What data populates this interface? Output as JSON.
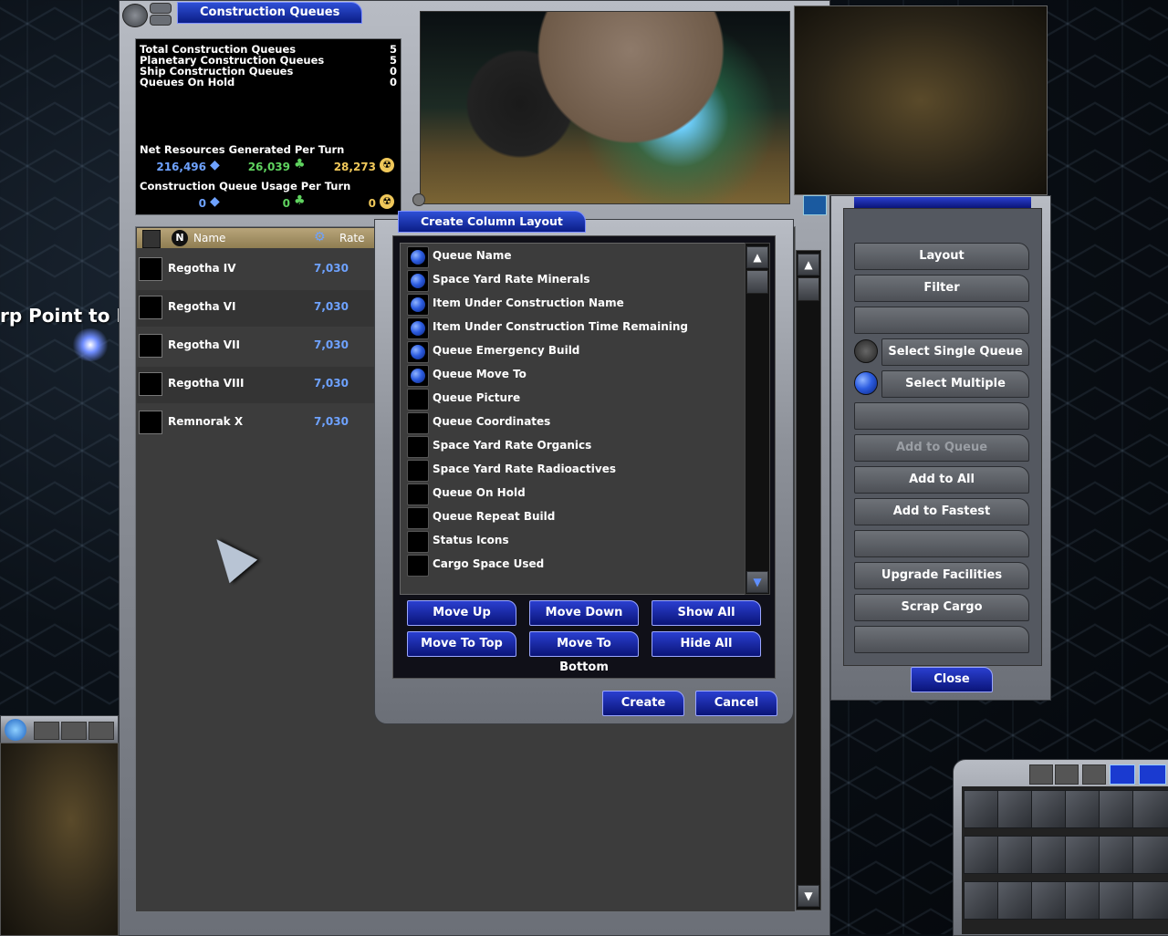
{
  "window": {
    "title": "Construction Queues"
  },
  "background_text": "rp Point to Re",
  "summary": {
    "lines": [
      {
        "label": "Total Construction Queues",
        "value": "5"
      },
      {
        "label": "Planetary Construction Queues",
        "value": "5"
      },
      {
        "label": "Ship Construction Queues",
        "value": "0"
      },
      {
        "label": "Queues On Hold",
        "value": "0"
      }
    ],
    "net_resources_label": "Net Resources Generated Per Turn",
    "net_resources": {
      "minerals": "216,496",
      "organics": "26,039",
      "radioactives": "28,273"
    },
    "usage_label": "Construction Queue Usage Per Turn",
    "usage": {
      "minerals": "0",
      "organics": "0",
      "radioactives": "0"
    }
  },
  "queue_table": {
    "headers": {
      "name": "Name",
      "rate": "Rate"
    },
    "rows": [
      {
        "name": "Regotha IV",
        "rate": "7,030"
      },
      {
        "name": "Regotha VI",
        "rate": "7,030"
      },
      {
        "name": "Regotha VII",
        "rate": "7,030"
      },
      {
        "name": "Regotha VIII",
        "rate": "7,030"
      },
      {
        "name": "Remnorak X",
        "rate": "7,030"
      }
    ]
  },
  "dialog": {
    "title": "Create Column Layout",
    "columns": [
      {
        "label": "Queue Name",
        "checked": true
      },
      {
        "label": "Space Yard Rate Minerals",
        "checked": true
      },
      {
        "label": "Item Under Construction Name",
        "checked": true
      },
      {
        "label": "Item Under Construction Time Remaining",
        "checked": true
      },
      {
        "label": "Queue Emergency Build",
        "checked": true
      },
      {
        "label": "Queue Move To",
        "checked": true
      },
      {
        "label": "Queue Picture",
        "checked": false
      },
      {
        "label": "Queue Coordinates",
        "checked": false
      },
      {
        "label": "Space Yard Rate Organics",
        "checked": false
      },
      {
        "label": "Space Yard Rate Radioactives",
        "checked": false
      },
      {
        "label": "Queue On Hold",
        "checked": false
      },
      {
        "label": "Queue Repeat Build",
        "checked": false
      },
      {
        "label": "Status Icons",
        "checked": false
      },
      {
        "label": "Cargo Space Used",
        "checked": false
      }
    ],
    "buttons": {
      "move_up": "Move Up",
      "move_down": "Move Down",
      "show_all": "Show All",
      "move_to_top": "Move To Top",
      "move_to_bottom": "Move To Bottom",
      "hide_all": "Hide All",
      "create": "Create",
      "cancel": "Cancel"
    }
  },
  "side_panel": {
    "layout": "Layout",
    "filter": "Filter",
    "select_single": "Select Single Queue",
    "select_multiple": "Select Multiple Queues",
    "add_to_queue": "Add to Queue",
    "add_to_all": "Add to All",
    "add_to_fastest": "Add to Fastest",
    "upgrade_facilities": "Upgrade Facilities",
    "scrap_cargo": "Scrap Cargo",
    "close": "Close"
  },
  "colors": {
    "accent_blue": "#2a3fd0",
    "rate_blue": "#6ea2ff",
    "minerals": "#6ea2ff",
    "organics": "#5fd35f",
    "radioactives": "#f0c85a"
  }
}
